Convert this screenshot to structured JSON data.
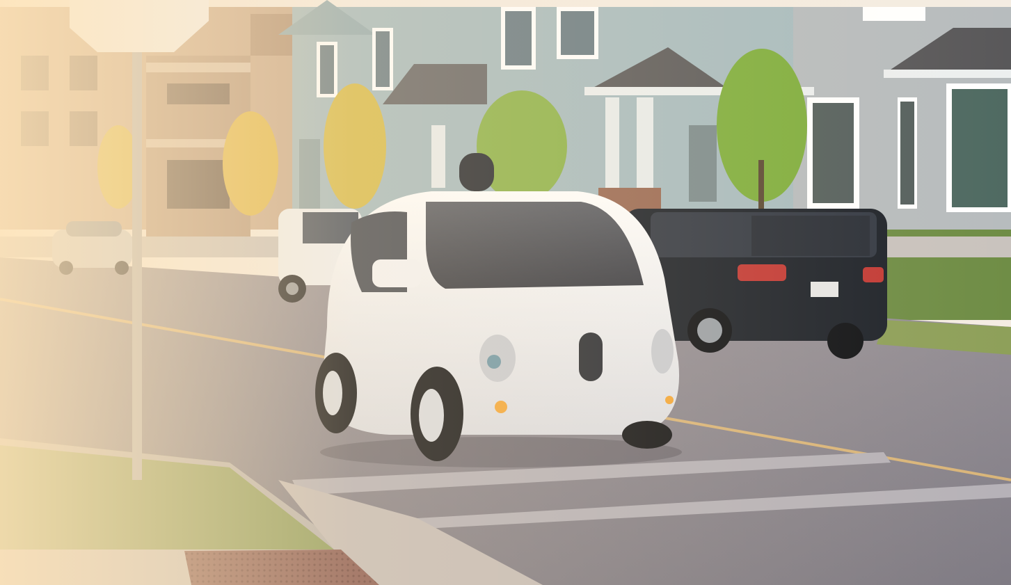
{
  "scene": {
    "colors": {
      "sky": "#f6efe6",
      "house_blue": "#a9bcc0",
      "house_gray": "#b9bec0",
      "apartment_tan": "#c8a98c",
      "road": "#8d8a90",
      "grass": "#8f9d5e",
      "sidewalk": "#c9c2bd",
      "brick_grate": "#8a5a52",
      "car_white": "#f3f3f4",
      "suv_black": "#1d2128",
      "tree_green": "#7fae3e",
      "tree_yellow": "#d9b94a"
    }
  }
}
